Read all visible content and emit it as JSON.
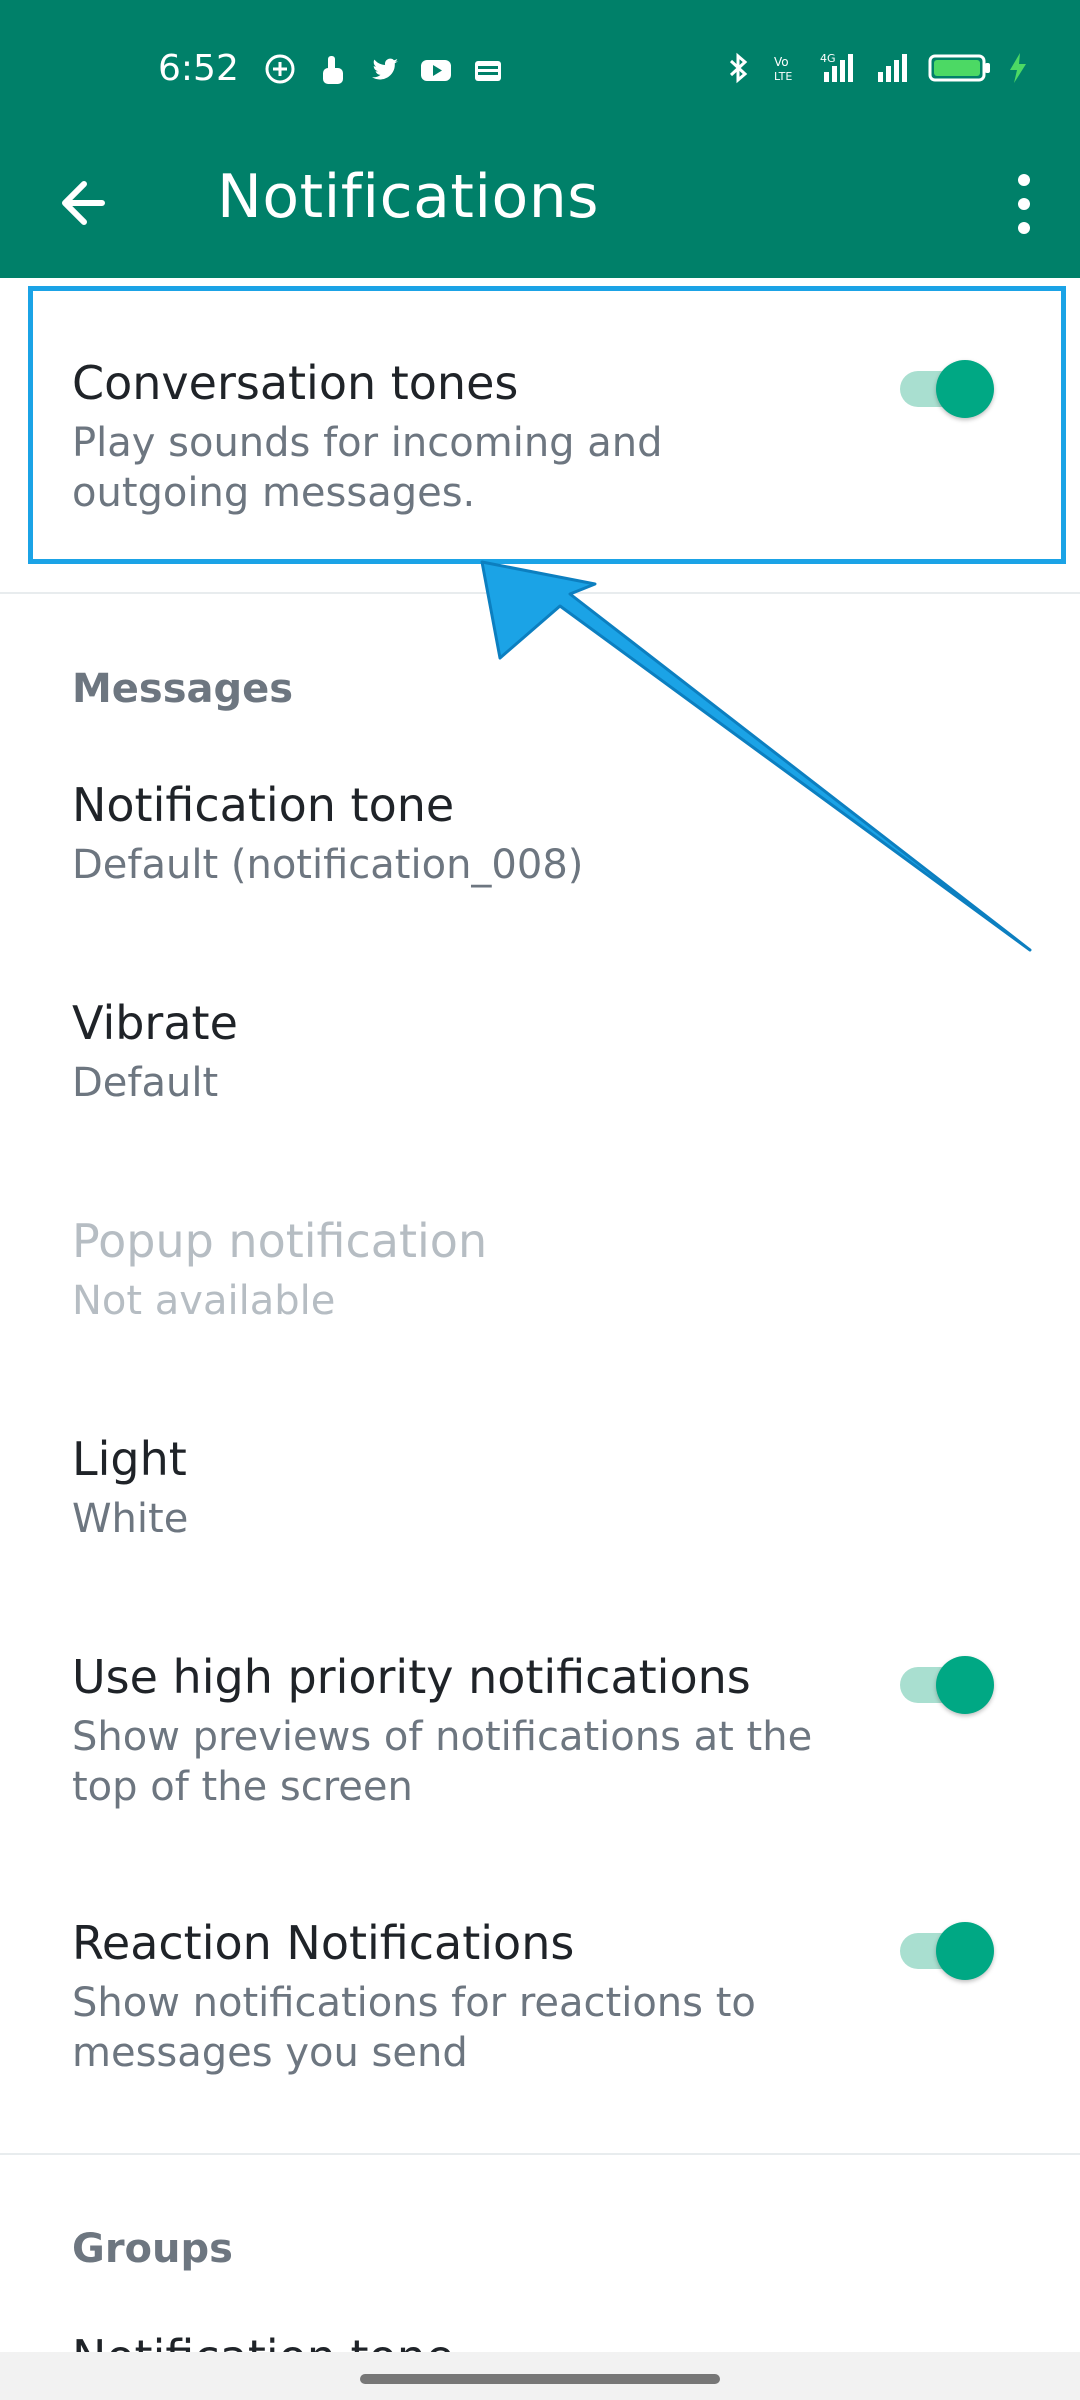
{
  "status": {
    "time": "6:52",
    "left_icons": [
      "chat-bubble-icon",
      "touch-icon",
      "twitter-icon",
      "youtube-icon",
      "wallet-icon"
    ],
    "right_icons": [
      "bluetooth-icon",
      "volte-icon",
      "signal-4g-icon",
      "signal-icon",
      "battery-icon",
      "charging-icon"
    ],
    "battery_percent": 95
  },
  "appbar": {
    "title": "Notifications",
    "back_icon": "back-arrow-icon",
    "more_icon": "more-vertical-icon"
  },
  "settings": {
    "conversation_tones": {
      "title": "Conversation tones",
      "subtitle": "Play sounds for incoming and outgoing messages.",
      "enabled": true
    },
    "messages_header": "Messages",
    "notification_tone": {
      "title": "Notification tone",
      "subtitle": "Default (notification_008)"
    },
    "vibrate": {
      "title": "Vibrate",
      "subtitle": "Default"
    },
    "popup_notification": {
      "title": "Popup notification",
      "subtitle": "Not available"
    },
    "light": {
      "title": "Light",
      "subtitle": "White"
    },
    "high_priority": {
      "title": "Use high priority notifications",
      "subtitle": "Show previews of notifications at the top of the screen",
      "enabled": true
    },
    "reaction_notifications": {
      "title": "Reaction Notifications",
      "subtitle": "Show notifications for reactions to messages you send",
      "enabled": true
    },
    "groups_header": "Groups",
    "groups_partial_title": "Notification tone"
  },
  "colors": {
    "brand": "#008069",
    "toggle_on": "#00a884",
    "highlight": "#1ba3e6"
  }
}
